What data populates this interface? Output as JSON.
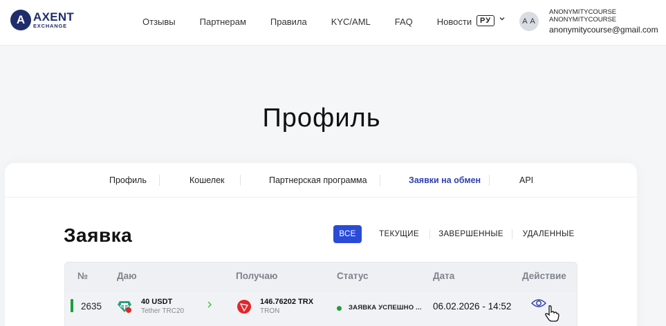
{
  "logo": {
    "mark": "A",
    "name": "AXENT",
    "sub": "EXCHANGE"
  },
  "nav": [
    "Отзывы",
    "Партнерам",
    "Правила",
    "KYC/AML",
    "FAQ",
    "Новости"
  ],
  "lang": {
    "code": "РУ"
  },
  "user": {
    "initials": "A A",
    "line1": "ANONYMITYCOURSE",
    "line2": "ANONYMITYCOURSE",
    "email": "anonymitycourse@gmail.com"
  },
  "page_title": "Профиль",
  "profile_tabs": [
    {
      "label": "Профиль",
      "active": false
    },
    {
      "label": "Кошелек",
      "active": false
    },
    {
      "label": "Партнерская программа",
      "active": false
    },
    {
      "label": "Заявки на обмен",
      "active": true
    },
    {
      "label": "API",
      "active": false
    }
  ],
  "section_title": "Заявка",
  "filters": [
    {
      "label": "ВСЕ",
      "active": true
    },
    {
      "label": "ТЕКУЩИЕ",
      "active": false
    },
    {
      "label": "ЗАВЕРШЕННЫЕ",
      "active": false
    },
    {
      "label": "УДАЛЕННЫЕ",
      "active": false
    }
  ],
  "table": {
    "headers": [
      "№",
      "Даю",
      "Получаю",
      "Статус",
      "Дата",
      "Действие"
    ],
    "rows": [
      {
        "id": "2635",
        "give_amount": "40 USDT",
        "give_network": "Tether TRC20",
        "give_icon": "tether-icon",
        "receive_amount": "146.76202 TRX",
        "receive_network": "TRON",
        "receive_icon": "tron-icon",
        "status": "ЗАЯВКА УСПЕШНО ...",
        "date": "06.02.2026 - 14:52",
        "action_icon": "eye-icon"
      }
    ]
  },
  "colors": {
    "brand": "#1f2d6b",
    "accent": "#2a4bd7",
    "active_tab": "#2f3fb0",
    "status_success": "#1e9e3a",
    "tron_red": "#e0262c",
    "tether_green": "#26a17b"
  }
}
